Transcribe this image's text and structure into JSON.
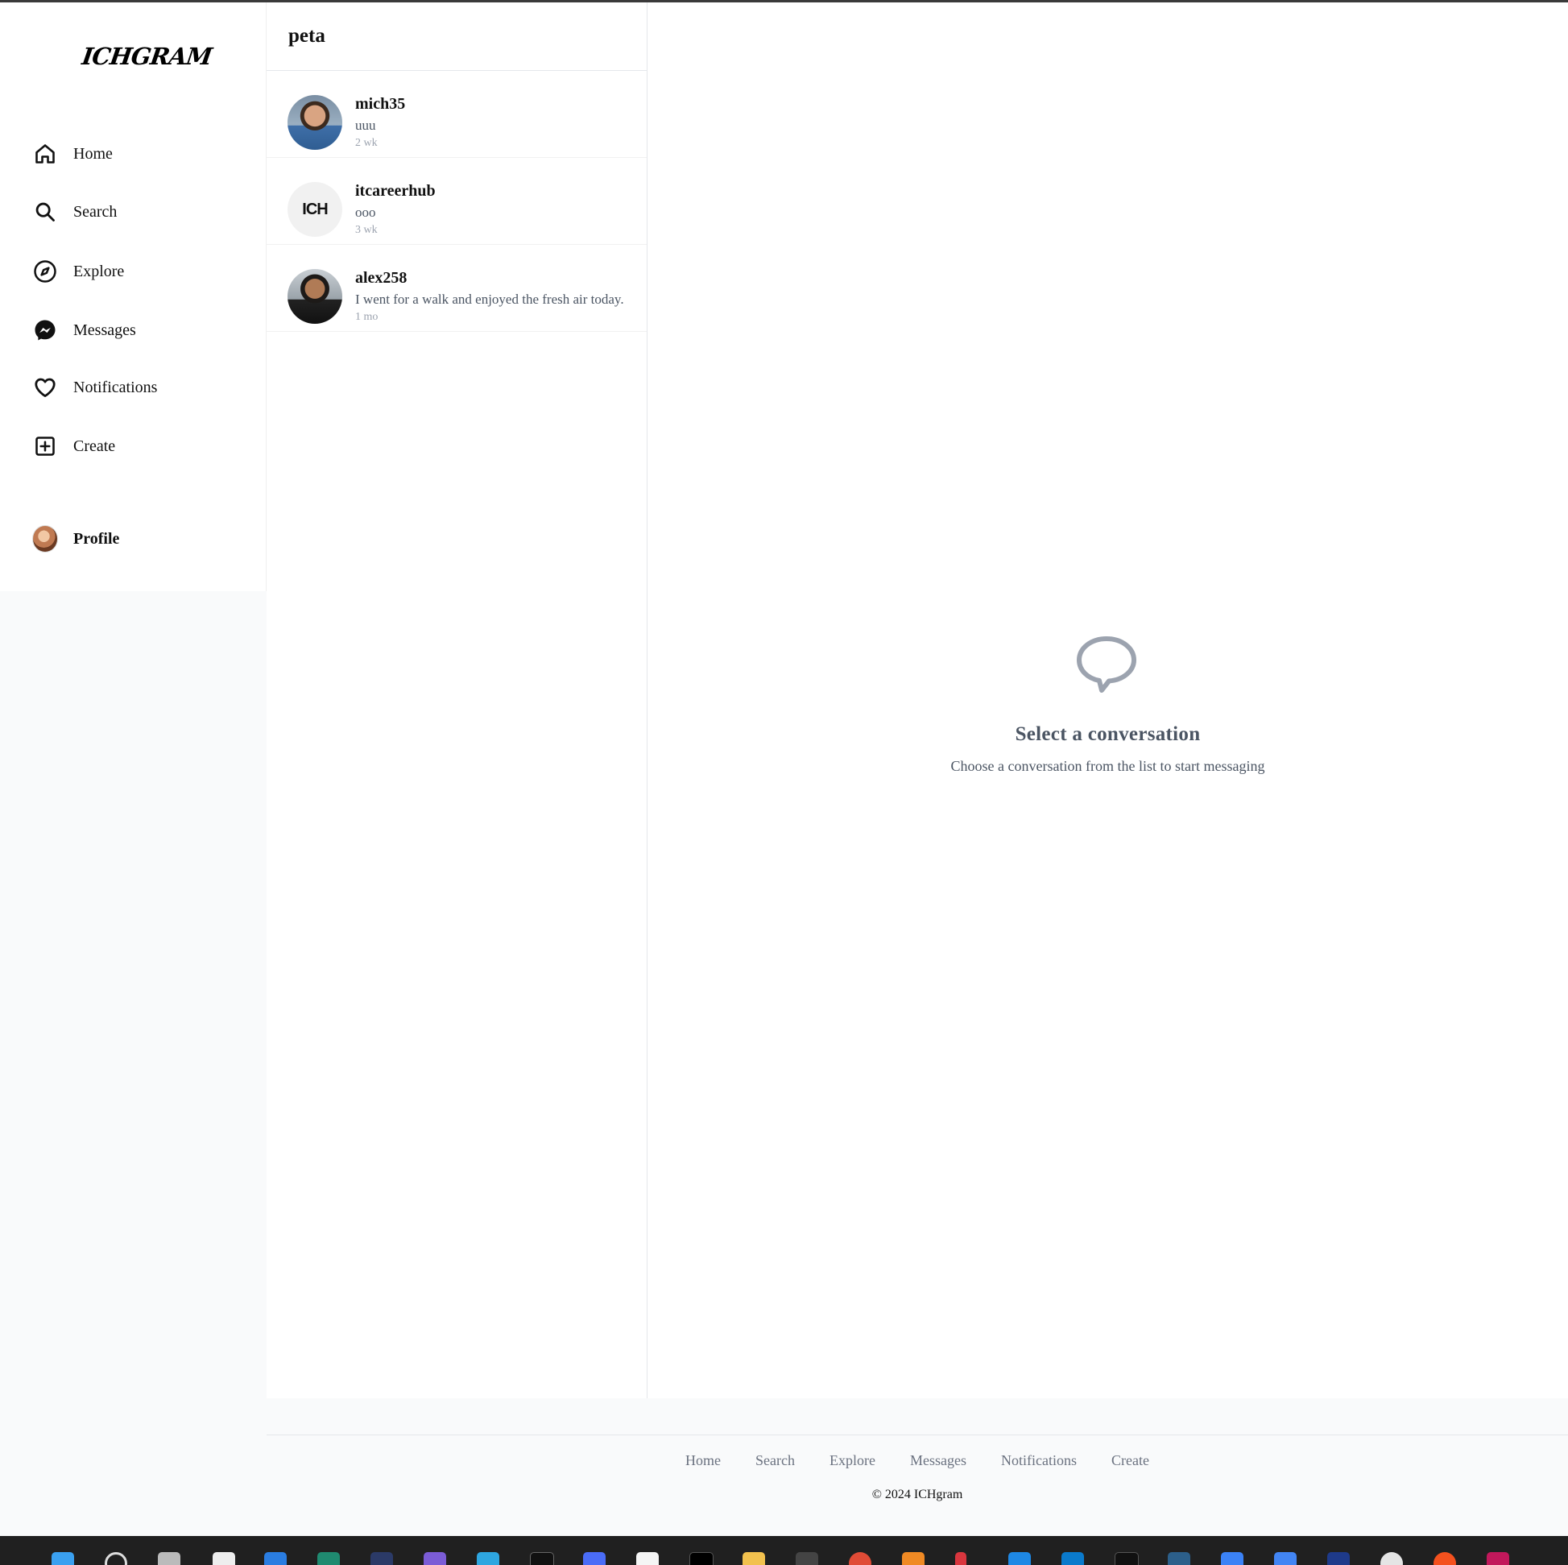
{
  "app": {
    "logo": "ICHGRAM"
  },
  "sidebar": {
    "items": [
      {
        "label": "Home",
        "icon": "home-icon"
      },
      {
        "label": "Search",
        "icon": "search-icon"
      },
      {
        "label": "Explore",
        "icon": "compass-icon"
      },
      {
        "label": "Messages",
        "icon": "messenger-icon"
      },
      {
        "label": "Notifications",
        "icon": "heart-icon"
      },
      {
        "label": "Create",
        "icon": "plus-square-icon"
      }
    ],
    "profile": {
      "label": "Profile"
    }
  },
  "conversations": {
    "current_user": "peta",
    "items": [
      {
        "name": "mich35",
        "last_message": "uuu",
        "time": "2 wk"
      },
      {
        "name": "itcareerhub",
        "last_message": "ooo",
        "time": "3 wk",
        "avatar_text": "ICH"
      },
      {
        "name": "alex258",
        "last_message": "I went for a walk and enjoyed the fresh air today.",
        "time": "1 mo"
      }
    ]
  },
  "main": {
    "empty_title": "Select a conversation",
    "empty_subtitle": "Choose a conversation from the list to start messaging",
    "icon": "chat-bubble-icon"
  },
  "footer": {
    "links": [
      "Home",
      "Search",
      "Explore",
      "Messages",
      "Notifications",
      "Create"
    ],
    "copyright": "© 2024 ICHgram"
  },
  "colors": {
    "page_bg": "#f9fafb",
    "muted_text": "#4b5563",
    "footer_link": "#6b7280",
    "taskbar": "#202020"
  }
}
